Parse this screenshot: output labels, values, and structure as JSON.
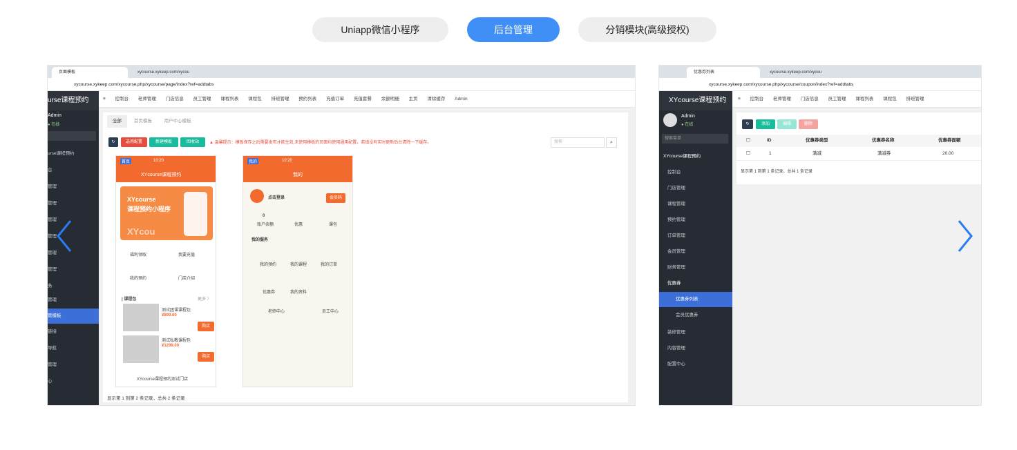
{
  "tabs": [
    {
      "label": "Uniapp微信小程序"
    },
    {
      "label": "后台管理"
    },
    {
      "label": "分销模块(高级授权)"
    }
  ],
  "left": {
    "browser_tab_1": "页面模板",
    "browser_tab_2": "xycourse.xykeep.com/xycou",
    "url": "xycourse.xykeep.com/xycourse.php/xycourse/page/index?ref=addtabs",
    "brand": "urse课程预约",
    "user": "Admin",
    "status": "● 在线",
    "side": [
      "urse课程预约",
      "台",
      "管理",
      "管理",
      "管理",
      "管理",
      "管理",
      "管理",
      "务",
      "管理",
      "管模板",
      "链接",
      "导航",
      "管理",
      "心"
    ],
    "topnav": [
      "控制台",
      "老师管理",
      "门店信息",
      "员工管理",
      "课程列表",
      "课程包",
      "排班管理",
      "预约列表",
      "充值订单",
      "充值套餐",
      "余额明细"
    ],
    "topright": [
      "主页",
      "清除缓存",
      "Admin"
    ],
    "subtabs": [
      "全部",
      "首页模板",
      "用户中心模板"
    ],
    "btns": [
      "选用配置",
      "新建模板",
      "回收站"
    ],
    "warning": "▲ 温馨提示：模板保存之后需要发布才能生效,未使用模板的页面均使用通用配置，若填没有实时更新后台清除一下缓存。",
    "search_placeholder": "搜索",
    "footer": "显示第 1 到第 2 条记录，总共 2 条记录",
    "phone1": {
      "tag": "首页",
      "time": "10:20",
      "title": "XYcourse课程预约",
      "banner1": "XYcourse",
      "banner2": "课程预约小程序",
      "banner3": "XYcou",
      "g1": "福利领取",
      "g2": "我要充值",
      "g3": "我的预约",
      "g4": "门店介绍",
      "pkg": "| 课程包",
      "more": "更多 〉",
      "c1": "测试团课课程包",
      "p1": "¥899.00",
      "c2": "测试私教课程包",
      "p2": "¥1299.00",
      "buy": "购买",
      "store": "XYcourse课程预约测试门店"
    },
    "phone2": {
      "tag": "我的",
      "time": "10:20",
      "title": "我的",
      "login": "点击登录",
      "member": "会员码",
      "s1v": "0",
      "s1": "账户余额",
      "s2": "优惠",
      "s3": "课包",
      "svc": "我的服务",
      "m1": "我的预约",
      "m2": "我的课程",
      "m3": "我的订单",
      "m4": "优惠券",
      "m5": "我的资料",
      "t1": "老师中心",
      "t2": "员工中心"
    }
  },
  "right": {
    "browser_tab_1": "优惠券列表",
    "browser_tab_2": "xycourse.xykeep.com/xycou",
    "url": "xycourse.xykeep.com/xycourse.php/xycourse/coupon/index?ref=addtabs",
    "brand": "XYcourse课程预约",
    "user": "Admin",
    "status": "● 在线",
    "search": "搜索菜单",
    "side": [
      "XYcourse课程预约",
      "控制台",
      "门店管理",
      "课程管理",
      "预约管理",
      "订单管理",
      "会员管理",
      "财务管理",
      "优惠券",
      "优惠券列表",
      "会员优惠券",
      "装修管理",
      "内容管理",
      "配置中心"
    ],
    "topnav": [
      "控制台",
      "老师管理",
      "门店信息",
      "员工管理",
      "课程列表",
      "课程包",
      "排班管理"
    ],
    "btns": [
      "添加",
      "编辑",
      "删除"
    ],
    "headers": [
      "ID",
      "优惠券类型",
      "优惠券名称",
      "优惠券面额"
    ],
    "row": [
      "1",
      "满减",
      "满减券",
      "20.00"
    ],
    "footer": "显示第 1 到第 1 条记录，总共 1 条记录"
  },
  "colors": {
    "accent": "#3f8ff7",
    "orange": "#f26a2e",
    "sidebar": "#272c34",
    "active": "#3d6fd8"
  }
}
